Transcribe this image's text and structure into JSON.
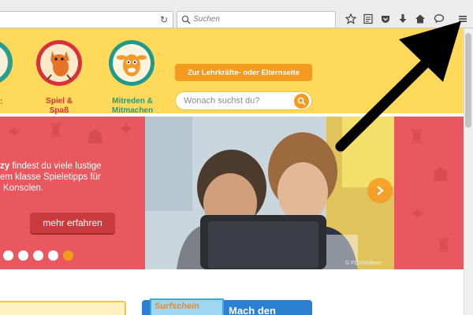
{
  "browser": {
    "search_placeholder": "Suchen",
    "reload_glyph": "↻"
  },
  "header": {
    "nav": [
      {
        "label_line1": "Spiel &",
        "label_line2": "Spaß",
        "color": "#d2323a"
      },
      {
        "label_line1": "Mitreden &",
        "label_line2": "Mitmachen",
        "color": "#1f9a8a"
      }
    ],
    "cta_label": "Zur Lehrkräfte- oder Elternseite",
    "search_placeholder": "Wonach suchst du?"
  },
  "hero": {
    "text_bold": "zy",
    "text_line1": " findest du viele lustige",
    "text_line2": "em klasse Spieletipps für",
    "text_line3": "Konsolen.",
    "button_label": "mehr erfahren",
    "photo_credit": "© FOX/Volkner",
    "slide_count": 5,
    "active_slide": 4
  },
  "lower": {
    "badge_text": "Surfschein",
    "box_title": "Mach den"
  },
  "colors": {
    "header_bg": "#fed95a",
    "hero_bg": "#e8585e",
    "accent_orange": "#f49a1e",
    "blue_box": "#2d7fd1"
  }
}
